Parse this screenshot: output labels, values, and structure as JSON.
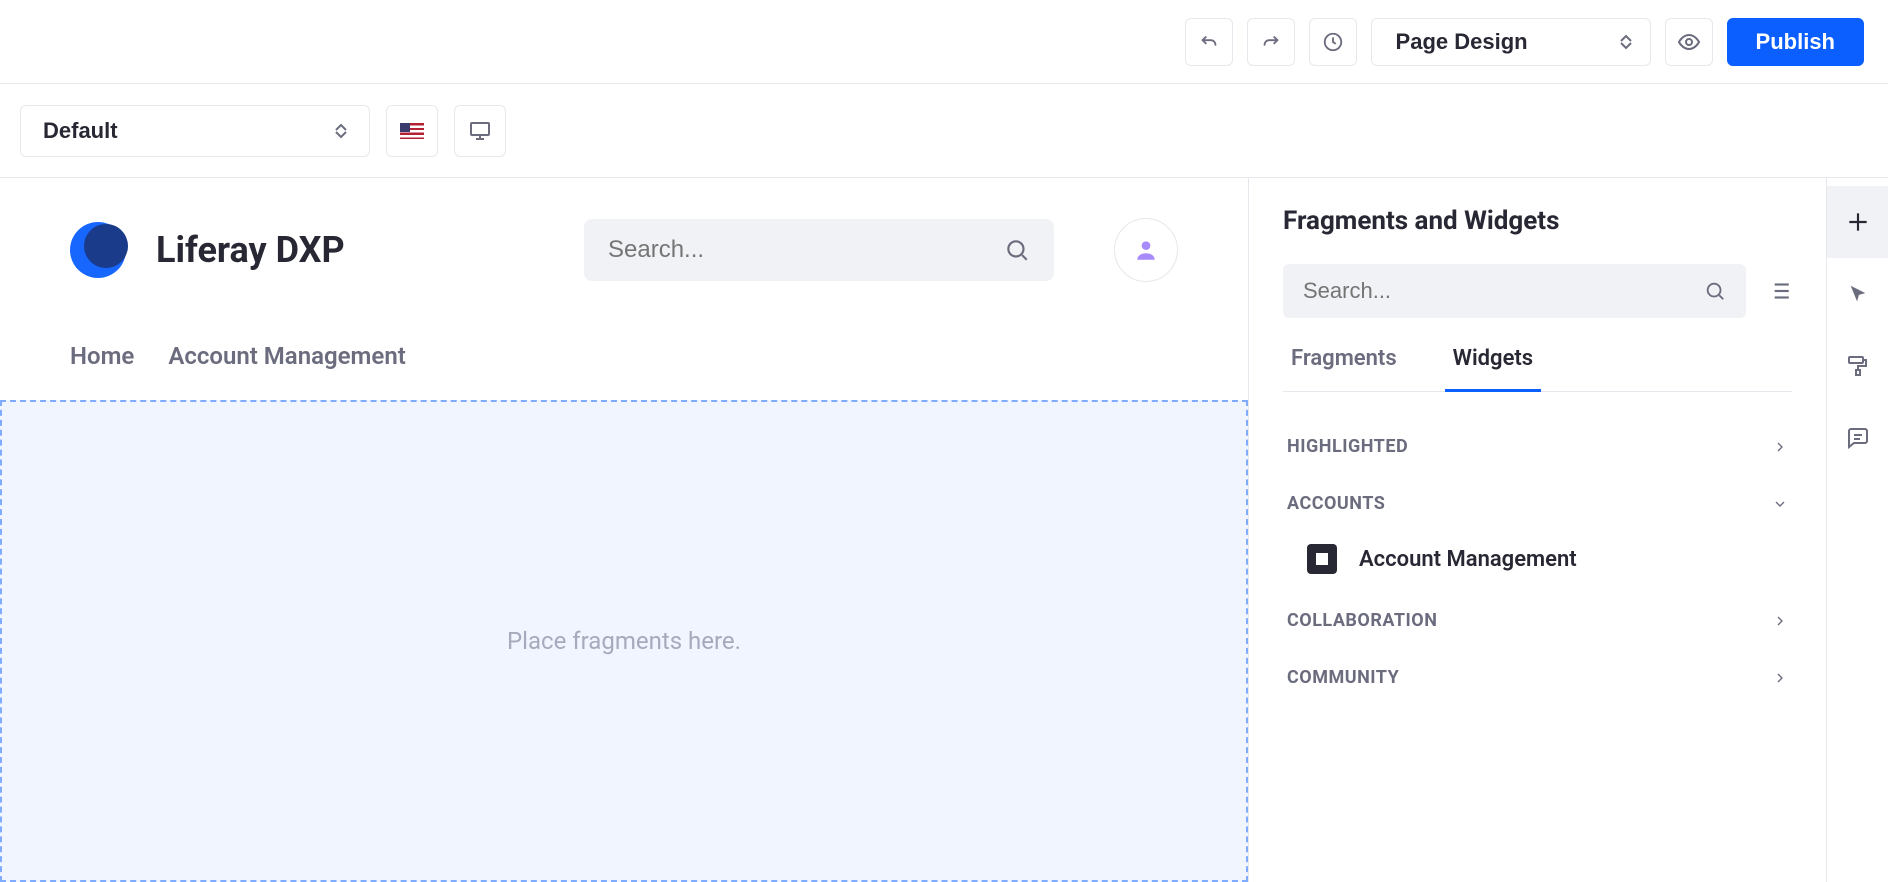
{
  "toolbar": {
    "mode_label": "Page Design",
    "publish_label": "Publish"
  },
  "subtoolbar": {
    "experience_label": "Default"
  },
  "page": {
    "brand": "Liferay DXP",
    "search_placeholder": "Search...",
    "nav": [
      "Home",
      "Account Management"
    ],
    "dropzone_text": "Place fragments here."
  },
  "panel": {
    "title": "Fragments and Widgets",
    "search_placeholder": "Search...",
    "tabs": {
      "fragments": "Fragments",
      "widgets": "Widgets",
      "active": "widgets"
    },
    "categories": [
      {
        "name": "HIGHLIGHTED",
        "expanded": false,
        "items": []
      },
      {
        "name": "ACCOUNTS",
        "expanded": true,
        "items": [
          "Account Management"
        ]
      },
      {
        "name": "COLLABORATION",
        "expanded": false,
        "items": []
      },
      {
        "name": "COMMUNITY",
        "expanded": false,
        "items": []
      }
    ]
  }
}
